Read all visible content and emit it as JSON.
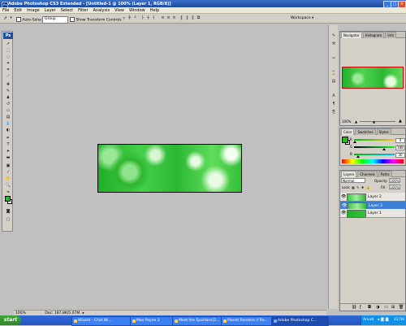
{
  "window": {
    "title": "Adobe Photoshop CS3 Extended - [Untitled-1 @ 100% (Layer 1, RGB/8)]"
  },
  "menu": [
    "File",
    "Edit",
    "Image",
    "Layer",
    "Select",
    "Filter",
    "Analysis",
    "View",
    "Window",
    "Help"
  ],
  "options": {
    "auto_select_label": "Auto-Select:",
    "auto_select_value": "Group",
    "transform_label": "Show Transform Controls",
    "workspace_label": "Workspace ▾"
  },
  "toolbox": {
    "badge": "Ps"
  },
  "status": {
    "zoom": "100%",
    "doc": "Doc: 187.8K/5.07M"
  },
  "navigator": {
    "tabs": [
      "Navigator",
      "Histogram",
      "Info"
    ],
    "zoom": "100%"
  },
  "color_panel": {
    "tabs": [
      "Color",
      "Swatches",
      "Styles"
    ],
    "r": "0",
    "g": "188",
    "b": "30",
    "fg_color": "#1ebc1e"
  },
  "layers_panel": {
    "tabs": [
      "Layers",
      "Channels",
      "Paths"
    ],
    "blend_mode": "Normal",
    "opacity_label": "Opacity:",
    "opacity_value": "100%",
    "lock_label": "Lock:",
    "fill_label": "Fill:",
    "fill_value": "100%",
    "layers": [
      {
        "name": "Layer 2",
        "selected": false
      },
      {
        "name": "Layer 3",
        "selected": true
      },
      {
        "name": "Layer 1",
        "selected": false
      }
    ]
  },
  "taskbar": {
    "start": "start",
    "tasks": [
      "Wizard - Chat Wi...",
      "Max Payne 2",
      "Meet the Spartans(2...",
      "Planet Renders // Re...",
      "Adobe Photoshop C..."
    ],
    "tray_lang": "Arvuti",
    "clock": "22:59"
  }
}
